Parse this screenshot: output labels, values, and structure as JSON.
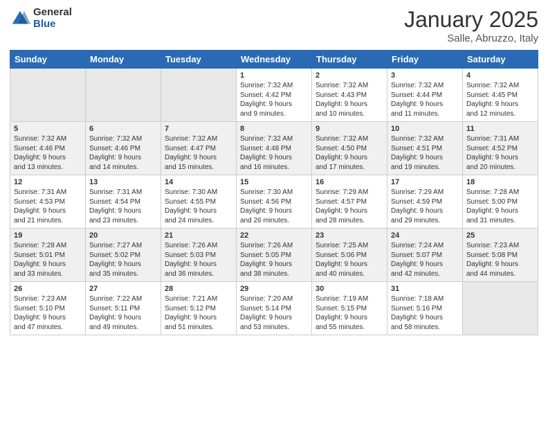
{
  "logo": {
    "general": "General",
    "blue": "Blue"
  },
  "header": {
    "month": "January 2025",
    "location": "Salle, Abruzzo, Italy"
  },
  "weekdays": [
    "Sunday",
    "Monday",
    "Tuesday",
    "Wednesday",
    "Thursday",
    "Friday",
    "Saturday"
  ],
  "weeks": [
    [
      {
        "day": "",
        "info": ""
      },
      {
        "day": "",
        "info": ""
      },
      {
        "day": "",
        "info": ""
      },
      {
        "day": "1",
        "info": "Sunrise: 7:32 AM\nSunset: 4:42 PM\nDaylight: 9 hours\nand 9 minutes."
      },
      {
        "day": "2",
        "info": "Sunrise: 7:32 AM\nSunset: 4:43 PM\nDaylight: 9 hours\nand 10 minutes."
      },
      {
        "day": "3",
        "info": "Sunrise: 7:32 AM\nSunset: 4:44 PM\nDaylight: 9 hours\nand 11 minutes."
      },
      {
        "day": "4",
        "info": "Sunrise: 7:32 AM\nSunset: 4:45 PM\nDaylight: 9 hours\nand 12 minutes."
      }
    ],
    [
      {
        "day": "5",
        "info": "Sunrise: 7:32 AM\nSunset: 4:46 PM\nDaylight: 9 hours\nand 13 minutes."
      },
      {
        "day": "6",
        "info": "Sunrise: 7:32 AM\nSunset: 4:46 PM\nDaylight: 9 hours\nand 14 minutes."
      },
      {
        "day": "7",
        "info": "Sunrise: 7:32 AM\nSunset: 4:47 PM\nDaylight: 9 hours\nand 15 minutes."
      },
      {
        "day": "8",
        "info": "Sunrise: 7:32 AM\nSunset: 4:48 PM\nDaylight: 9 hours\nand 16 minutes."
      },
      {
        "day": "9",
        "info": "Sunrise: 7:32 AM\nSunset: 4:50 PM\nDaylight: 9 hours\nand 17 minutes."
      },
      {
        "day": "10",
        "info": "Sunrise: 7:32 AM\nSunset: 4:51 PM\nDaylight: 9 hours\nand 19 minutes."
      },
      {
        "day": "11",
        "info": "Sunrise: 7:31 AM\nSunset: 4:52 PM\nDaylight: 9 hours\nand 20 minutes."
      }
    ],
    [
      {
        "day": "12",
        "info": "Sunrise: 7:31 AM\nSunset: 4:53 PM\nDaylight: 9 hours\nand 21 minutes."
      },
      {
        "day": "13",
        "info": "Sunrise: 7:31 AM\nSunset: 4:54 PM\nDaylight: 9 hours\nand 23 minutes."
      },
      {
        "day": "14",
        "info": "Sunrise: 7:30 AM\nSunset: 4:55 PM\nDaylight: 9 hours\nand 24 minutes."
      },
      {
        "day": "15",
        "info": "Sunrise: 7:30 AM\nSunset: 4:56 PM\nDaylight: 9 hours\nand 26 minutes."
      },
      {
        "day": "16",
        "info": "Sunrise: 7:29 AM\nSunset: 4:57 PM\nDaylight: 9 hours\nand 28 minutes."
      },
      {
        "day": "17",
        "info": "Sunrise: 7:29 AM\nSunset: 4:59 PM\nDaylight: 9 hours\nand 29 minutes."
      },
      {
        "day": "18",
        "info": "Sunrise: 7:28 AM\nSunset: 5:00 PM\nDaylight: 9 hours\nand 31 minutes."
      }
    ],
    [
      {
        "day": "19",
        "info": "Sunrise: 7:28 AM\nSunset: 5:01 PM\nDaylight: 9 hours\nand 33 minutes."
      },
      {
        "day": "20",
        "info": "Sunrise: 7:27 AM\nSunset: 5:02 PM\nDaylight: 9 hours\nand 35 minutes."
      },
      {
        "day": "21",
        "info": "Sunrise: 7:26 AM\nSunset: 5:03 PM\nDaylight: 9 hours\nand 36 minutes."
      },
      {
        "day": "22",
        "info": "Sunrise: 7:26 AM\nSunset: 5:05 PM\nDaylight: 9 hours\nand 38 minutes."
      },
      {
        "day": "23",
        "info": "Sunrise: 7:25 AM\nSunset: 5:06 PM\nDaylight: 9 hours\nand 40 minutes."
      },
      {
        "day": "24",
        "info": "Sunrise: 7:24 AM\nSunset: 5:07 PM\nDaylight: 9 hours\nand 42 minutes."
      },
      {
        "day": "25",
        "info": "Sunrise: 7:23 AM\nSunset: 5:08 PM\nDaylight: 9 hours\nand 44 minutes."
      }
    ],
    [
      {
        "day": "26",
        "info": "Sunrise: 7:23 AM\nSunset: 5:10 PM\nDaylight: 9 hours\nand 47 minutes."
      },
      {
        "day": "27",
        "info": "Sunrise: 7:22 AM\nSunset: 5:11 PM\nDaylight: 9 hours\nand 49 minutes."
      },
      {
        "day": "28",
        "info": "Sunrise: 7:21 AM\nSunset: 5:12 PM\nDaylight: 9 hours\nand 51 minutes."
      },
      {
        "day": "29",
        "info": "Sunrise: 7:20 AM\nSunset: 5:14 PM\nDaylight: 9 hours\nand 53 minutes."
      },
      {
        "day": "30",
        "info": "Sunrise: 7:19 AM\nSunset: 5:15 PM\nDaylight: 9 hours\nand 55 minutes."
      },
      {
        "day": "31",
        "info": "Sunrise: 7:18 AM\nSunset: 5:16 PM\nDaylight: 9 hours\nand 58 minutes."
      },
      {
        "day": "",
        "info": ""
      }
    ]
  ]
}
